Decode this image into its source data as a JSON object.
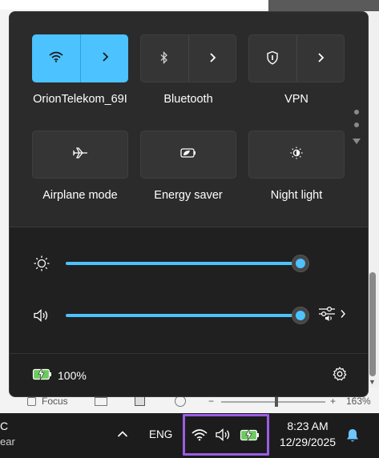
{
  "background_app": {
    "status": {
      "focus_label": "Focus",
      "zoom_minus": "−",
      "zoom_plus": "+",
      "zoom_level": "163%"
    }
  },
  "quick_settings": {
    "tiles_row1": [
      {
        "label": "OrionTelekom_69I",
        "icon": "wifi-icon",
        "active": true
      },
      {
        "label": "Bluetooth",
        "icon": "bluetooth-icon",
        "active": false
      },
      {
        "label": "VPN",
        "icon": "shield-icon",
        "active": false
      }
    ],
    "tiles_row2": [
      {
        "label": "Airplane mode",
        "icon": "airplane-icon",
        "active": false
      },
      {
        "label": "Energy saver",
        "icon": "leaf-battery-icon",
        "active": false
      },
      {
        "label": "Night light",
        "icon": "night-light-icon",
        "active": false
      }
    ],
    "brightness": {
      "icon": "sun-icon",
      "level": 1.0
    },
    "volume": {
      "icon": "speaker-icon",
      "level": 1.0
    },
    "battery": {
      "icon": "battery-charging-icon",
      "text": "100%"
    },
    "accent_color": "#4cc2ff"
  },
  "taskbar": {
    "weather_line1": "C",
    "weather_line2": "ear",
    "language": "ENG",
    "time": "8:23 AM",
    "date": "12/29/2025",
    "tray_highlight_color": "#9b5de5"
  }
}
